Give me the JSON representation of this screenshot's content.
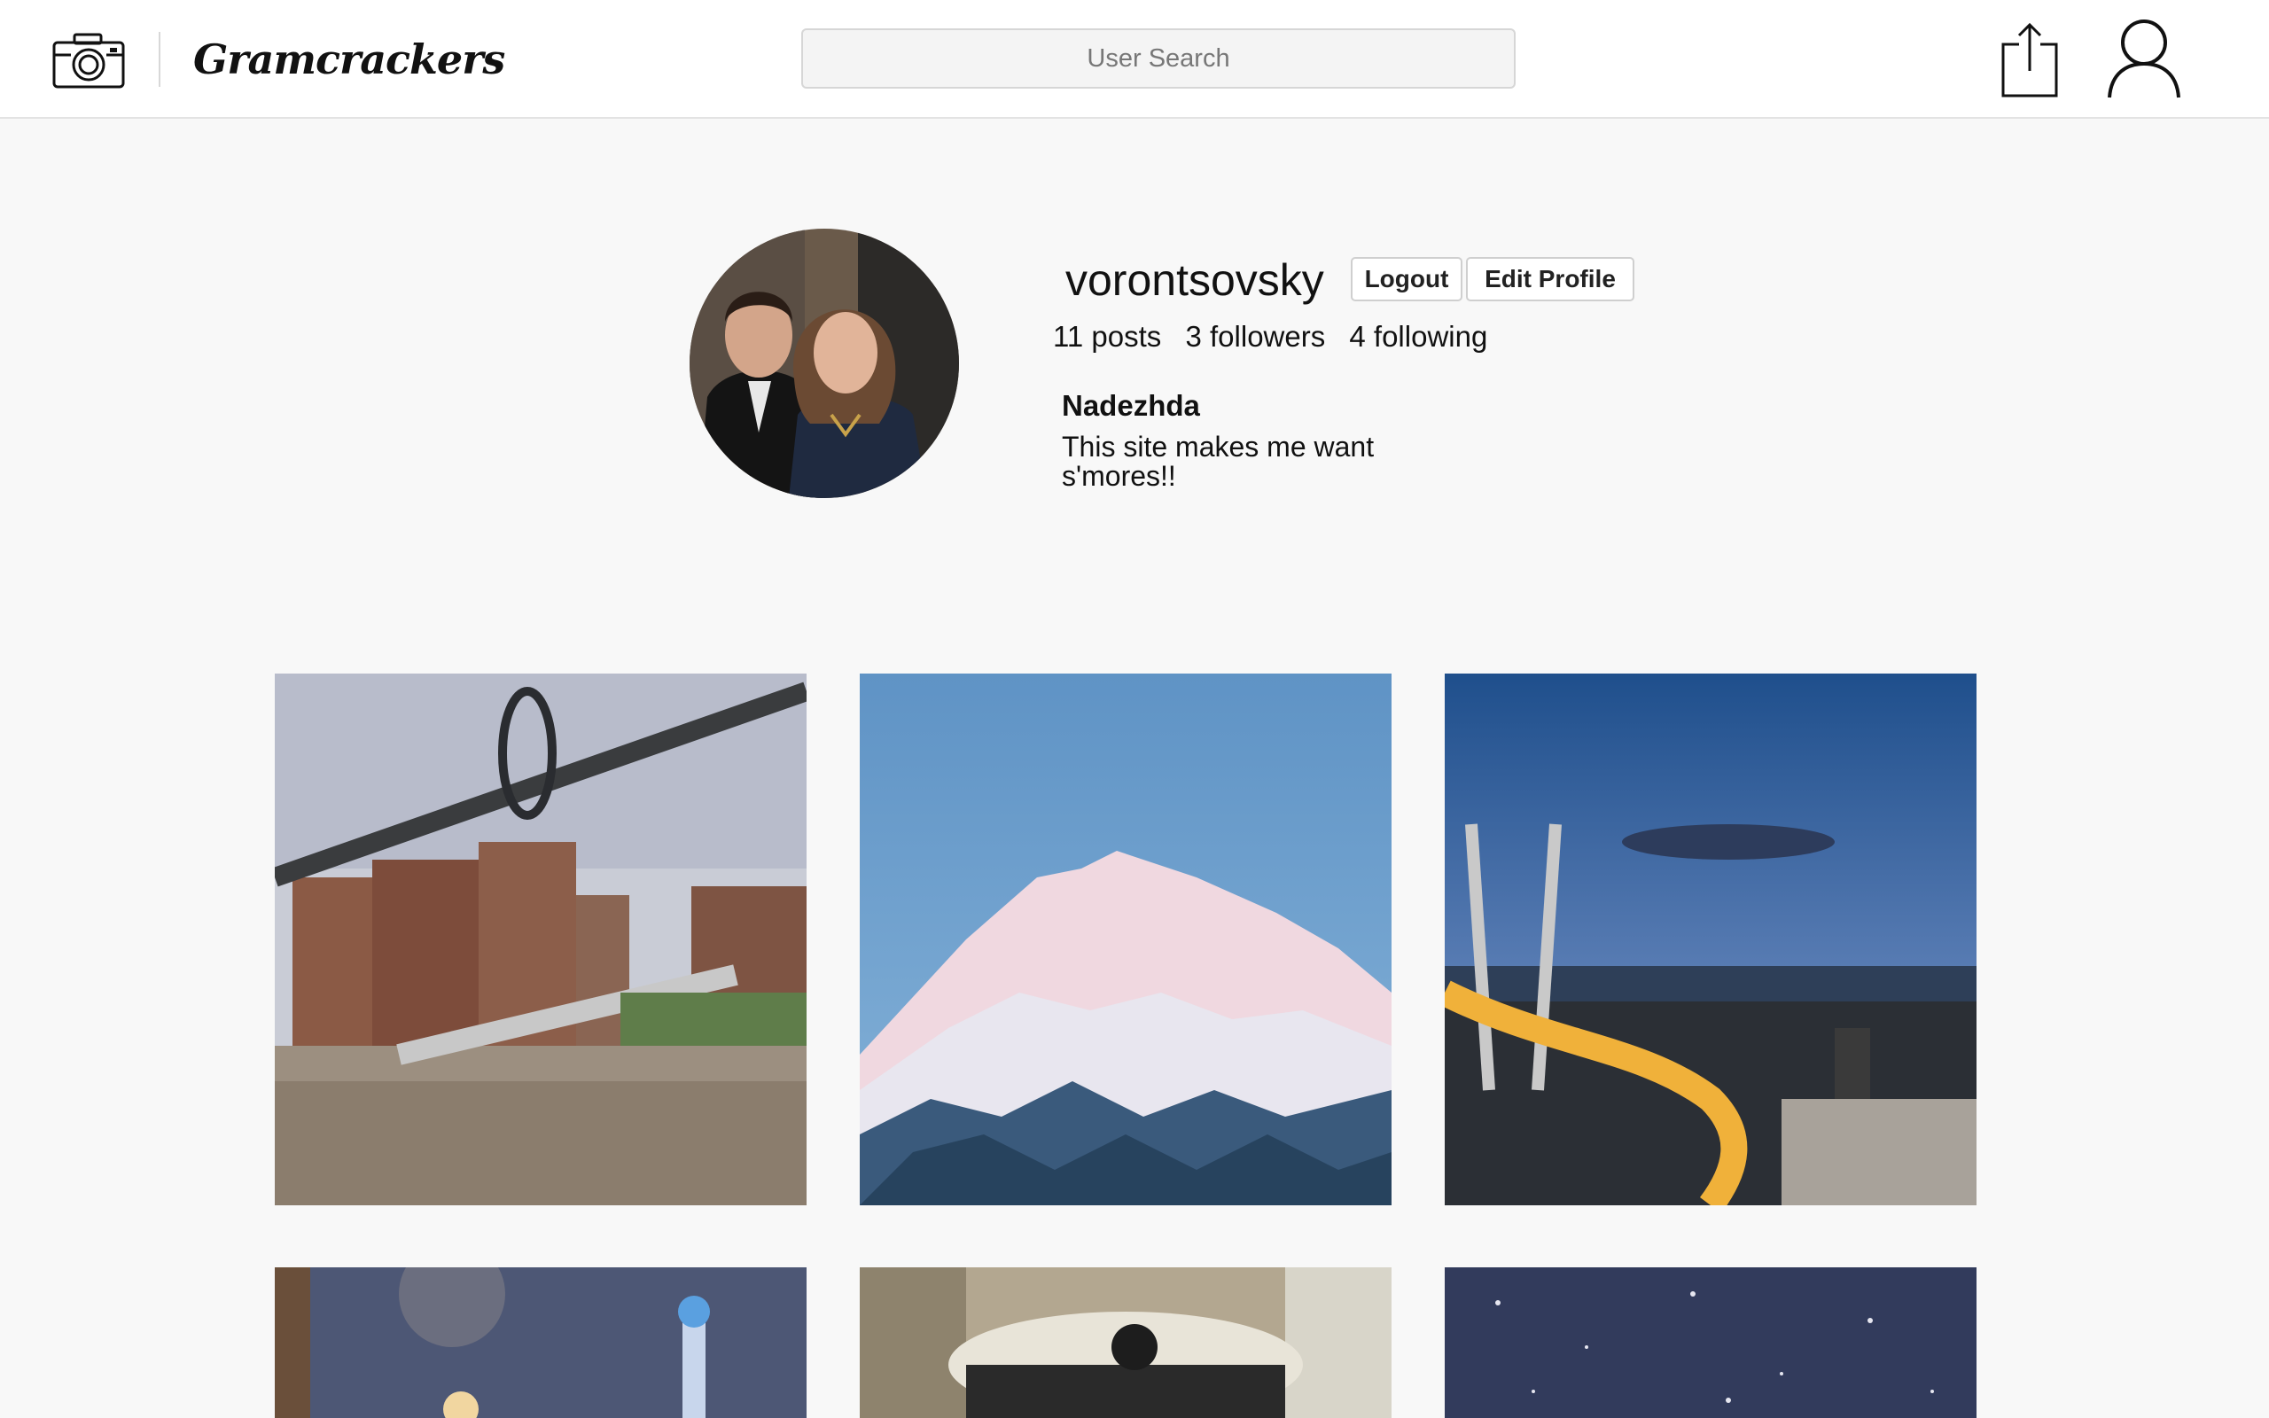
{
  "nav": {
    "brand": "Gramcrackers",
    "search_placeholder": "User Search"
  },
  "profile": {
    "username": "vorontsovsky",
    "logout_label": "Logout",
    "edit_label": "Edit Profile",
    "posts": "11 posts",
    "followers": "3 followers",
    "following": "4 following",
    "full_name": "Nadezhda",
    "bio": "This site makes me want s'mores!!"
  },
  "icons": {
    "camera": "camera-icon",
    "upload": "share-upload-icon",
    "profile": "user-icon"
  }
}
